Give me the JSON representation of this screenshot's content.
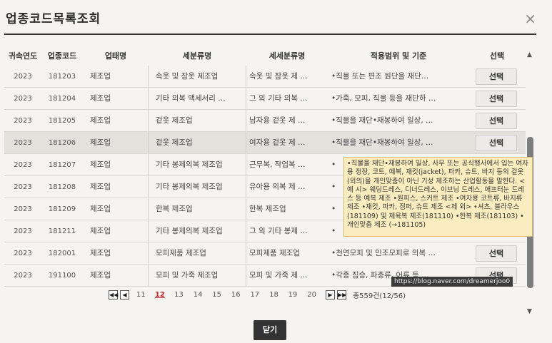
{
  "dialog": {
    "title": "업종코드목록조회",
    "close_icon": "×"
  },
  "columns": {
    "year": "귀속연도",
    "code": "업종코드",
    "biz": "업태명",
    "sub": "세분류명",
    "subsub": "세세분류명",
    "scope": "적용범위 및 기준",
    "select": "선택"
  },
  "rows": [
    {
      "year": "2023",
      "code": "181203",
      "biz": "제조업",
      "sub": "속옷 및 잠옷 제조업",
      "subsub": "속옷 및 잠옷 제 …",
      "scope": "•직물 또는 편조 원단을 재단…",
      "select": "선택"
    },
    {
      "year": "2023",
      "code": "181204",
      "biz": "제조업",
      "sub": "기타 의복 액세서리 …",
      "subsub": "그 외 기타 의복 …",
      "scope": "•가죽, 모피, 직물 등을 재단하 …",
      "select": "선택"
    },
    {
      "year": "2023",
      "code": "181205",
      "biz": "제조업",
      "sub": "겉옷 제조업",
      "subsub": "남자용 겉옷 제 …",
      "scope": "•직물을 재단•재봉하여 일상, …",
      "select": "선택"
    },
    {
      "year": "2023",
      "code": "181206",
      "biz": "제조업",
      "sub": "겉옷 제조업",
      "subsub": "여자용 겉옷 제 …",
      "scope": "•직물을 재단•재봉하여 일상, …",
      "select": "선택"
    },
    {
      "year": "2023",
      "code": "181207",
      "biz": "제조업",
      "sub": "기타 봉제의복 제조업",
      "subsub": "근무복, 작업복 …",
      "scope": "•",
      "select": ""
    },
    {
      "year": "2023",
      "code": "181208",
      "biz": "제조업",
      "sub": "기타 봉제의복 제조업",
      "subsub": "유아용 의복 제 …",
      "scope": "•",
      "select": ""
    },
    {
      "year": "2023",
      "code": "181209",
      "biz": "제조업",
      "sub": "한복 제조업",
      "subsub": "한복 제조업",
      "scope": "•",
      "select": ""
    },
    {
      "year": "2023",
      "code": "181211",
      "biz": "제조업",
      "sub": "기타 봉제의복 제조업",
      "subsub": "그 외 기타 봉제 …",
      "scope": "•",
      "select": ""
    },
    {
      "year": "2023",
      "code": "182001",
      "biz": "제조업",
      "sub": "모피제품 제조업",
      "subsub": "모피제품 제조업",
      "scope": "•천연모피 및 인조모피로 의복 …",
      "select": "선택"
    },
    {
      "year": "2023",
      "code": "191100",
      "biz": "제조업",
      "sub": "모피 및 가죽 제조업",
      "subsub": "모피 및 가죽 제 …",
      "scope": "•각종 짐승, 파충류, 어류 등 …",
      "select": "선택"
    }
  ],
  "tooltip": {
    "text": "•직물을 재단•재봉하여 일상, 사무 또는 공식행사에서 입는 여자용 정장, 코트, 예복, 재킷(jacket), 파카, 슈트, 바지 등의 겉옷(외의)을 개인맞춤이 아닌 기성 제조하는 산업활동을 말한다. <예 시> 웨딩드레스, 디너드레스, 이브닝 드레스, 애프터눈 드레스 등 예복 제조 •원피스, 스커트 제조 •여자용 코트류, 바지류 제조 •재킷, 파카, 점퍼, 슈트 제조 <제 외> •셔츠, 블라우스(181109) 및 체육복 제조(181110) •한복 제조(181103) •개인맞춤 제조 (→181105)"
  },
  "pagination": {
    "first_icon": "◀◀",
    "prev_icon": "◀",
    "pages": [
      "11",
      "12",
      "13",
      "14",
      "15",
      "16",
      "17",
      "18",
      "19",
      "20"
    ],
    "current": "12",
    "next_icon": "▶",
    "last_icon": "▶▶",
    "total": "총559건(12/56)"
  },
  "watermark": "https://blog.naver.com/dreamerjoo0",
  "footer": {
    "close_label": "닫기"
  },
  "scroll": {
    "up_icon": "▲",
    "down_icon": "▼"
  }
}
